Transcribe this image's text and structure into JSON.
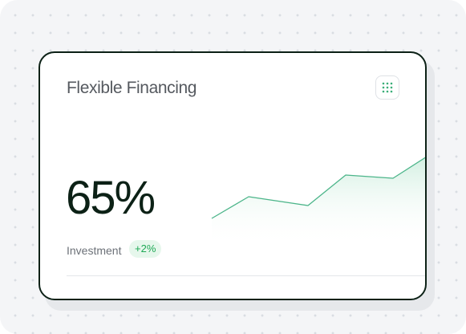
{
  "card": {
    "title": "Flexible Financing",
    "menu_icon": "grid-dots-icon",
    "value": "65%",
    "metric_label": "Investment",
    "delta": "+2%"
  },
  "colors": {
    "card_border": "#0c2116",
    "value_text": "#0c2116",
    "accent_green": "#1ea955",
    "badge_background": "#e6f7ec",
    "line_stroke": "#4cb58a"
  }
}
